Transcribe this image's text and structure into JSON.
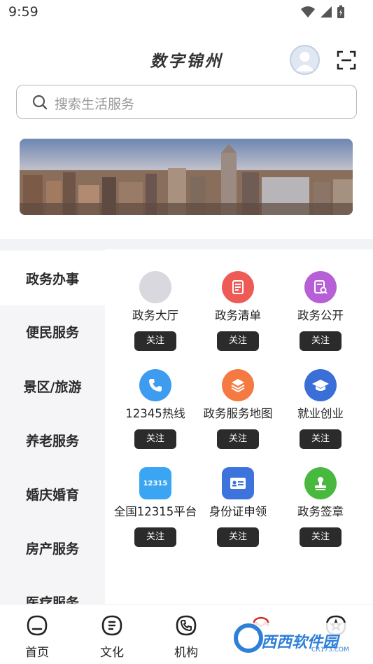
{
  "status_bar": {
    "time": "9:59"
  },
  "header": {
    "title": "数字锦州"
  },
  "search": {
    "placeholder": "搜索生活服务"
  },
  "categories": [
    {
      "label": "政务办事",
      "active": true
    },
    {
      "label": "便民服务",
      "active": false
    },
    {
      "label": "景区/旅游",
      "active": false
    },
    {
      "label": "养老服务",
      "active": false
    },
    {
      "label": "婚庆婚育",
      "active": false
    },
    {
      "label": "房产服务",
      "active": false
    },
    {
      "label": "医疗服务",
      "active": false
    }
  ],
  "services": [
    {
      "name": "政务大厅",
      "icon": "hall-placeholder-icon",
      "color": "#d8d8de",
      "follow": "关注"
    },
    {
      "name": "政务清单",
      "icon": "document-list-icon",
      "color": "#ee5a55",
      "follow": "关注"
    },
    {
      "name": "政务公开",
      "icon": "document-search-icon",
      "color": "#b65fd6",
      "follow": "关注"
    },
    {
      "name": "12345热线",
      "icon": "phone-icon",
      "color": "#3d9bf0",
      "follow": "关注"
    },
    {
      "name": "政务服务地图",
      "icon": "layers-icon",
      "color": "#f57a42",
      "follow": "关注"
    },
    {
      "name": "就业创业",
      "icon": "graduation-cap-icon",
      "color": "#3a6fd8",
      "follow": "关注"
    },
    {
      "name": "全国12315平台",
      "icon": "badge-12315-icon",
      "icon_text": "12315",
      "color": "#3aa5f2",
      "follow": "关注"
    },
    {
      "name": "身份证申领",
      "icon": "id-card-icon",
      "color": "#3d73dd",
      "follow": "关注"
    },
    {
      "name": "政务签章",
      "icon": "stamp-icon",
      "color": "#49b83e",
      "follow": "关注"
    }
  ],
  "bottom_nav": [
    {
      "label": "首页",
      "icon": "home-icon"
    },
    {
      "label": "文化",
      "icon": "culture-icon"
    },
    {
      "label": "机构",
      "icon": "phone-org-icon"
    },
    {
      "label": "",
      "icon": "mine-icon"
    },
    {
      "label": "",
      "icon": "star-badge-icon"
    }
  ],
  "watermark": {
    "text": "西西软件园",
    "sub": "CR173.COM"
  }
}
